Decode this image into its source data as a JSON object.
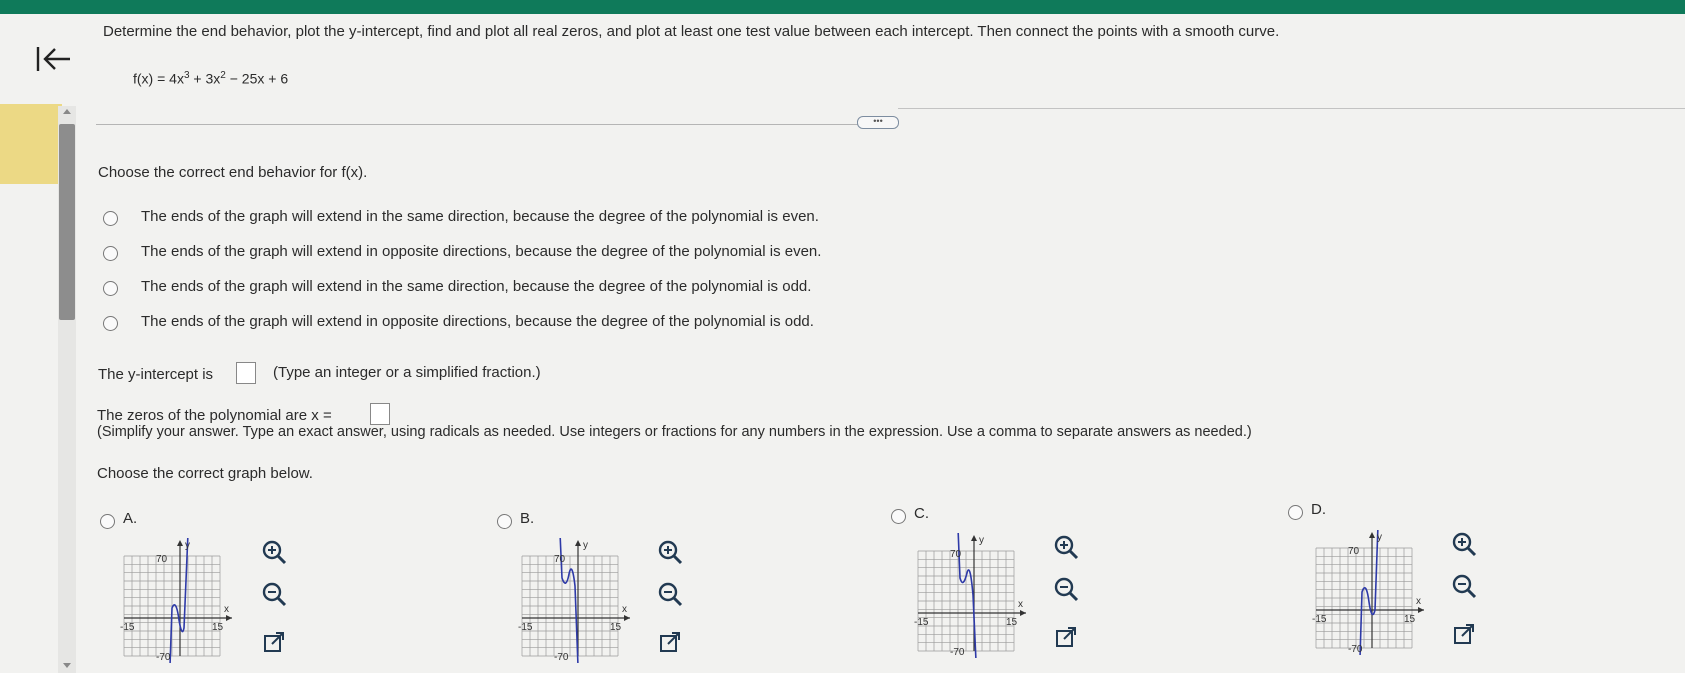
{
  "colors": {
    "accent_bar": "#0f7a5a",
    "tab_highlight": "#ecd985",
    "curve": "#2e3aa8",
    "icon": "#223a52"
  },
  "nav": {
    "back_icon": "back-arrow-icon"
  },
  "question": {
    "instruction": "Determine the end behavior, plot the y-intercept, find and plot all real zeros, and plot at least one test value between each intercept. Then connect the points with a smooth curve.",
    "function_lhs": "f(x) = 4x",
    "exp1": "3",
    "mid": " + 3x",
    "exp2": "2",
    "tail": " − 25x + 6",
    "more_label": "•••"
  },
  "end_behavior": {
    "prompt": "Choose the correct end behavior for f(x).",
    "options": [
      "The ends of the graph will extend in the same direction, because the degree of the polynomial is even.",
      "The ends of the graph will extend in opposite directions, because the degree of the polynomial is even.",
      "The ends of the graph will extend in the same direction, because the degree of the polynomial is odd.",
      "The ends of the graph will extend in opposite directions, because the degree of the polynomial is odd."
    ]
  },
  "y_intercept": {
    "label": "The y-intercept is",
    "hint": "(Type an integer or a simplified fraction.)",
    "value": ""
  },
  "zeros": {
    "label": "The zeros of the polynomial are x =",
    "value": "",
    "hint": "(Simplify your answer. Type an exact answer, using radicals as needed. Use integers or fractions for any numbers in the expression. Use a comma to separate answers as needed.)"
  },
  "graph_prompt": "Choose the correct graph below.",
  "graph_options": [
    {
      "letter": "A.",
      "y_label": "y",
      "x_label": "x",
      "y_max": "70",
      "y_min": "-70",
      "x_min": "-15",
      "x_max": "15"
    },
    {
      "letter": "B.",
      "y_label": "y",
      "x_label": "x",
      "y_max": "70",
      "y_min": "-70",
      "x_min": "-15",
      "x_max": "15"
    },
    {
      "letter": "C.",
      "y_label": "y",
      "x_label": "x",
      "y_max": "70",
      "y_min": "-70",
      "x_min": "-15",
      "x_max": "15"
    },
    {
      "letter": "D.",
      "y_label": "y",
      "x_label": "x",
      "y_max": "70",
      "y_min": "-70",
      "x_min": "-15",
      "x_max": "15"
    }
  ],
  "graph_tools": {
    "zoom_in": "zoom-in-icon",
    "zoom_out": "zoom-out-icon",
    "expand": "open-external-icon"
  }
}
